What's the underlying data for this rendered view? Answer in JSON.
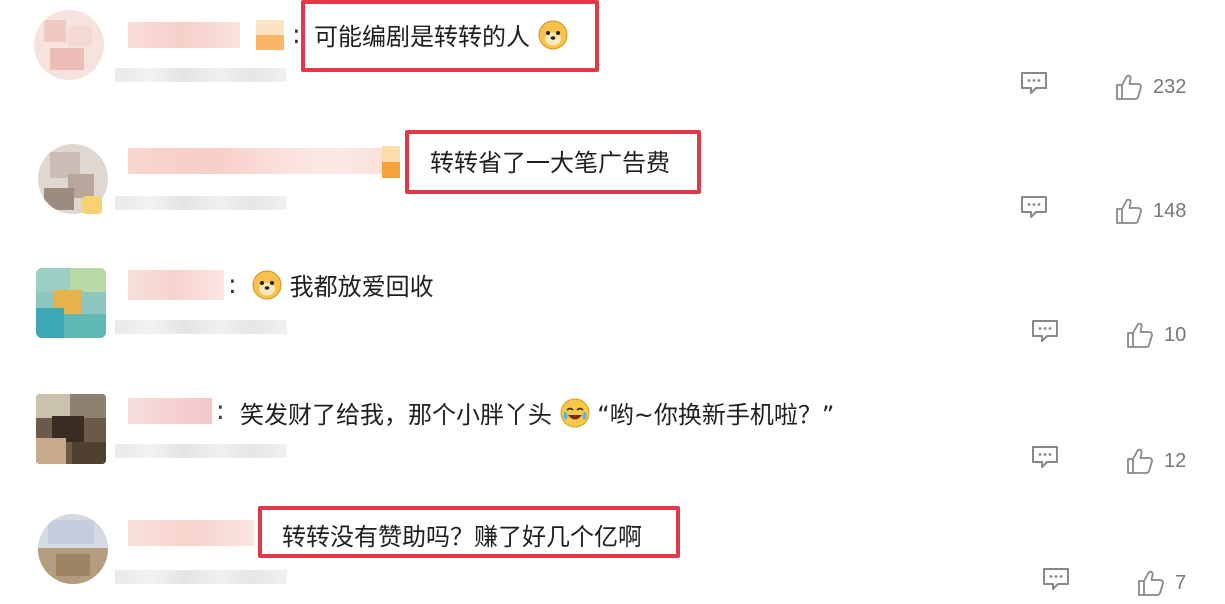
{
  "comments": [
    {
      "text": "可能编剧是转转的人",
      "emoji_after": "doge-emoji",
      "colon": ":",
      "like_count": "232",
      "highlighted": true
    },
    {
      "text": "转转省了一大笔广告费",
      "emoji_after": "",
      "colon": "",
      "like_count": "148",
      "highlighted": true
    },
    {
      "text": "我都放爱回收",
      "emoji_before": "doge-emoji",
      "colon": ":",
      "like_count": "10",
      "highlighted": false
    },
    {
      "text_a": "笑发财了给我，那个小胖丫头",
      "emoji_mid": "crying-laughing-emoji",
      "text_b": "“哟~你换新手机啦？”",
      "colon": ":",
      "like_count": "12",
      "highlighted": false
    },
    {
      "text": "转转没有赞助吗？赚了好几个亿啊",
      "colon": "",
      "like_count": "7",
      "highlighted": true
    }
  ],
  "icons": {
    "reply": "comment-icon",
    "like": "thumbs-up-icon"
  },
  "colors": {
    "highlight_border": "#e3384a",
    "icon_gray": "#888888",
    "count_gray": "#777777"
  }
}
